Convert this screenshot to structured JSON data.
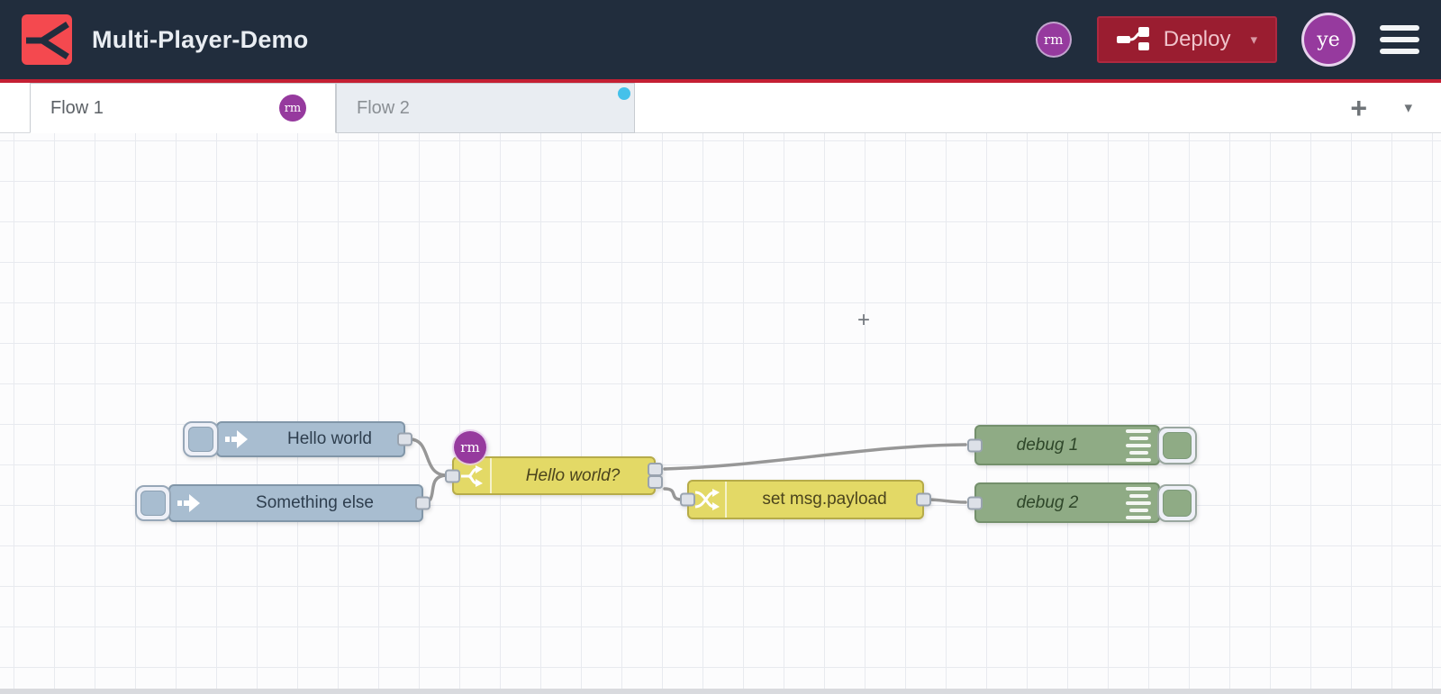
{
  "header": {
    "title": "Multi-Player-Demo",
    "collaborator_initials": "rm",
    "deploy": {
      "label": "Deploy",
      "caret": "▾"
    },
    "user_initials": "ye"
  },
  "tab_bar": {
    "tabs": [
      {
        "label": "Flow 1",
        "badge": "rm",
        "active": true,
        "modified": false
      },
      {
        "label": "Flow 2",
        "active": false,
        "modified": true
      }
    ],
    "add_label": "+",
    "list_caret": "▾"
  },
  "canvas": {
    "cursor": "+",
    "nodes": [
      {
        "type": "inject",
        "label": "Hello world"
      },
      {
        "type": "inject",
        "label": "Something else"
      },
      {
        "type": "switch",
        "label": "Hello world?",
        "badge": "rm",
        "outputs": 2
      },
      {
        "type": "change",
        "label": "set msg.payload"
      },
      {
        "type": "debug",
        "label": "debug 1"
      },
      {
        "type": "debug",
        "label": "debug 2"
      }
    ],
    "wires": [
      {
        "from": "Hello world",
        "to": "Hello world?"
      },
      {
        "from": "Something else",
        "to": "Hello world?"
      },
      {
        "from": "Hello world? output 1",
        "to": "debug 1"
      },
      {
        "from": "Hello world? output 2",
        "to": "set msg.payload"
      },
      {
        "from": "set msg.payload",
        "to": "debug 2"
      }
    ]
  },
  "colors": {
    "header_bg": "#212d3d",
    "accent_red": "#c41f33",
    "logo_red": "#f4494f",
    "deploy_bg": "#9a1d30",
    "avatar_purple": "#963a9e",
    "inject_node": "#a8bdd0",
    "function_yellow": "#e3d966",
    "debug_green": "#8fab85",
    "wire_gray": "#979797",
    "modified_dot_blue": "#45c1ea"
  }
}
